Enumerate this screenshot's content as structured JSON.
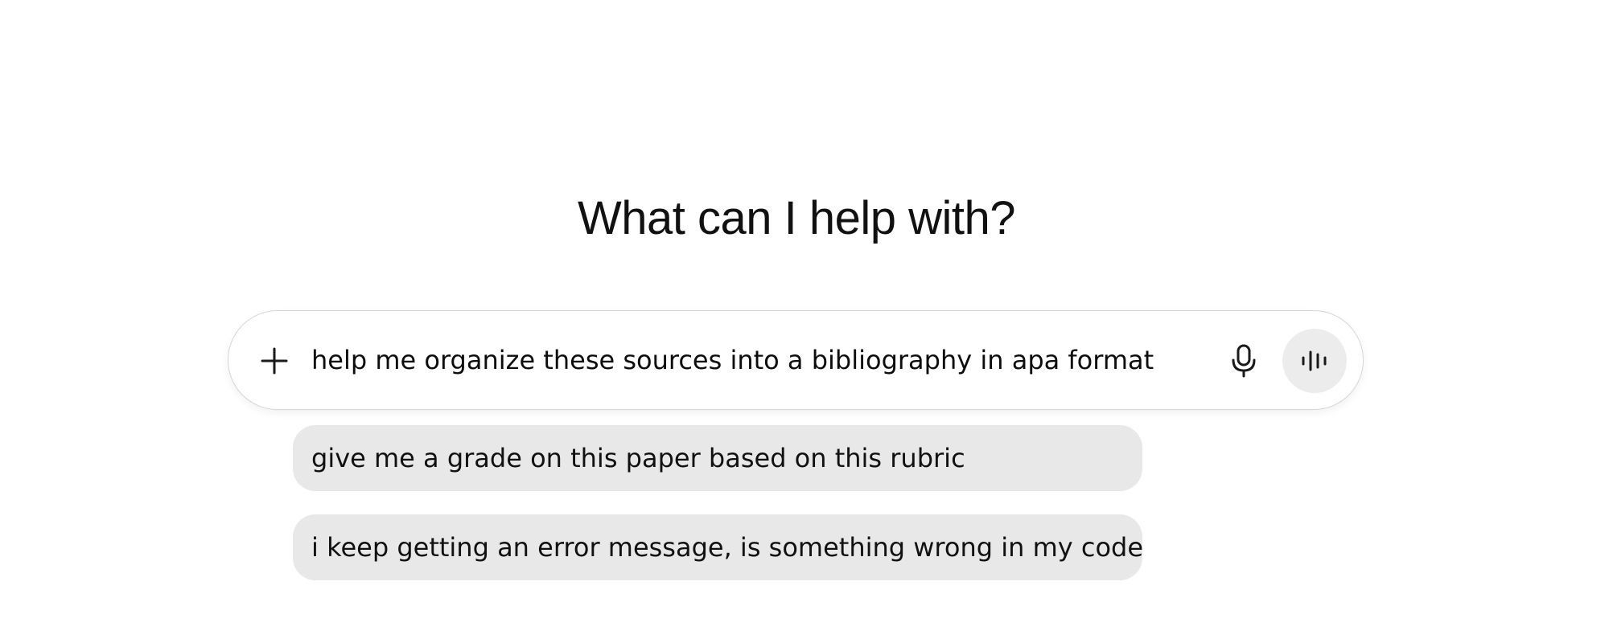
{
  "headline": "What can I help with?",
  "composer": {
    "value": "help me organize these sources into a bibliography in apa format",
    "icons": {
      "add": "plus-icon",
      "mic": "microphone-icon",
      "voice": "voice-waveform-icon"
    }
  },
  "suggestions": [
    {
      "label": "give me a grade on this paper based on this rubric"
    },
    {
      "label": "i keep getting an error message, is something wrong in my code?"
    }
  ]
}
